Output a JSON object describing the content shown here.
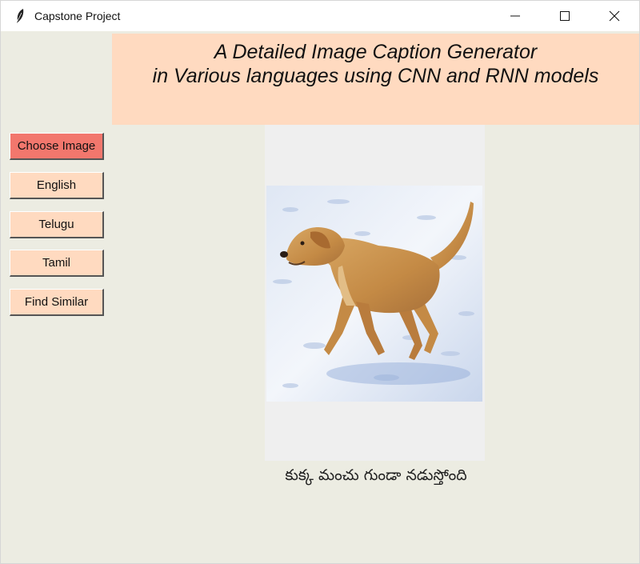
{
  "window": {
    "title": "Capstone Project",
    "icon": "feather-icon"
  },
  "banner": {
    "line1": "A Detailed Image Caption Generator",
    "line2": "in Various languages using CNN and RNN models"
  },
  "buttons": {
    "choose_image": "Choose Image",
    "english": "English",
    "telugu": "Telugu",
    "tamil": "Tamil",
    "find_similar": "Find Similar"
  },
  "image": {
    "subject": "dog-running-on-snow"
  },
  "caption": {
    "text": "కుక్క మంచు గుండా నడుస్తోంది"
  },
  "colors": {
    "banner_bg": "#ffdac0",
    "active_button": "#f2776d",
    "button_bg": "#ffdac0",
    "window_bg": "#ecece2"
  }
}
